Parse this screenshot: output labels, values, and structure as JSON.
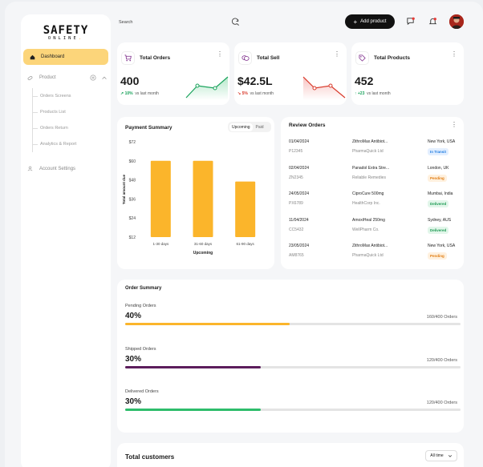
{
  "brand": {
    "logo_main": "SAFETY",
    "logo_sub": "ONLINE",
    "logo_dot": "."
  },
  "sidebar": {
    "dashboard": "Dashboard",
    "product": "Product",
    "sub_items": [
      "Orders Screens",
      "Products List",
      "Orders Return",
      "Analytics & Report"
    ],
    "account_settings": "Account Settings"
  },
  "topbar": {
    "search_placeholder": "Search",
    "add_product": "Add product",
    "add_icon": "+"
  },
  "stats": [
    {
      "title": "Total Orders",
      "value": "400",
      "delta": "10%",
      "delta_dir": "up",
      "note": "vs last month",
      "icon": "cart-icon"
    },
    {
      "title": "Total Sell",
      "value": "$42.5L",
      "delta": "5%",
      "delta_dir": "down",
      "note": "vs last month",
      "icon": "coins-icon"
    },
    {
      "title": "Total Products",
      "value": "452",
      "delta": "+23",
      "delta_dir": "up",
      "note": "vs last month",
      "icon": "tag-icon"
    }
  ],
  "payment_summary": {
    "title": "Payment Summary",
    "toggle_on": "Upcoming",
    "toggle_off": "Paid"
  },
  "chart_data": {
    "type": "bar",
    "categories": [
      "1-30 days",
      "31-60 days",
      "61-90 days"
    ],
    "values": [
      60,
      60,
      47
    ],
    "ylim": [
      12,
      72
    ],
    "yticks": [
      "$72",
      "$60",
      "$48",
      "$36",
      "$24",
      "$12"
    ],
    "ylabel": "Total amount due",
    "xlabel": "Upcoming",
    "color": "#fbb52b"
  },
  "review_orders": {
    "title": "Review Orders",
    "rows": [
      {
        "date": "01/04/2024",
        "id": "P12345",
        "product": "ZithroMax Antibiot...",
        "vendor": "PharmaQuick Ltd",
        "location": "New York, USA",
        "status": "In Transit",
        "status_color": "#1e7be0",
        "status_bg": "#e3efff"
      },
      {
        "date": "02/04/2024",
        "id": "ZN2345",
        "product": "Panadol Extra Stre...",
        "vendor": "Reliable Remedies",
        "location": "London, UK",
        "status": "Pending",
        "status_color": "#e07b0f",
        "status_bg": "#fff1df"
      },
      {
        "date": "24/05/2024",
        "id": "PX6789",
        "product": "CiproCure 500mg",
        "vendor": "HealthCorp Inc.",
        "location": "Mumbai, India",
        "status": "Delivered",
        "status_color": "#1c9a52",
        "status_bg": "#e2f6ea"
      },
      {
        "date": "11/04/2024",
        "id": "CC5432",
        "product": "AmoxiHeal 250mg",
        "vendor": "WellPharm Co.",
        "location": "Sydney, AUS",
        "status": "Delivered",
        "status_color": "#1c9a52",
        "status_bg": "#e2f6ea"
      },
      {
        "date": "23/05/2024",
        "id": "AM8765",
        "product": "ZithroMax Antibiot...",
        "vendor": "PharmaQuick Ltd",
        "location": "New York, USA",
        "status": "Pending",
        "status_color": "#e07b0f",
        "status_bg": "#fff1df"
      }
    ]
  },
  "order_summary": {
    "title": "Order Summary",
    "items": [
      {
        "label": "Pending Orders",
        "pct": "40%",
        "fraction": 0.49,
        "count": "160/400 Orders",
        "color": "#fbb52b"
      },
      {
        "label": "Shipped Orders",
        "pct": "30%",
        "fraction": 0.405,
        "count": "120/400 Orders",
        "color": "#5c1d5c"
      },
      {
        "label": "Delivered Orders",
        "pct": "30%",
        "fraction": 0.405,
        "count": "120/400 Orders",
        "color": "#2ebd6b"
      }
    ]
  },
  "total_customers": {
    "title": "Total customers",
    "filter": "All time"
  }
}
